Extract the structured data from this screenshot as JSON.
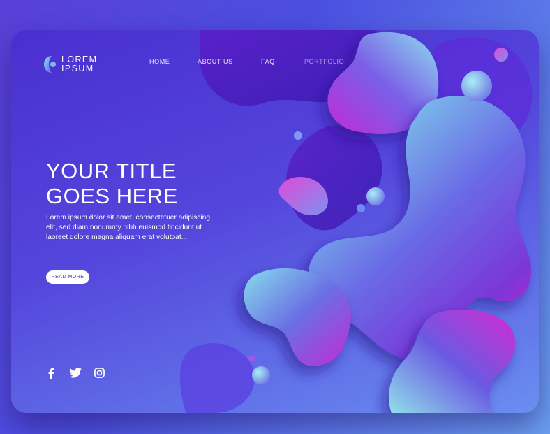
{
  "logo": {
    "line1": "LOREM",
    "line2": "IPSUM"
  },
  "nav": {
    "items": [
      {
        "label": "HOME"
      },
      {
        "label": "ABOUT US"
      },
      {
        "label": "FAQ"
      },
      {
        "label": "PORTFOLIO"
      }
    ]
  },
  "hero": {
    "title_line1": "YOUR TITLE",
    "title_line2": "GOES HERE",
    "description": "Lorem ipsum dolor sit amet, consectetuer adipiscing elit, sed diam nonummy nibh euismod tincidunt ut laoreet dolore magna aliquam erat volutpat...",
    "button_label": "READ MORE"
  },
  "social": {
    "icons": [
      "facebook-icon",
      "twitter-icon",
      "instagram-icon"
    ]
  },
  "colors": {
    "background_start": "#5a3fd6",
    "background_end": "#6aa0f0",
    "blob_cyan": "#7fd8e8",
    "blob_magenta": "#c42ad8",
    "blob_violet": "#5a2ad0",
    "button_text": "#4a30c8"
  }
}
